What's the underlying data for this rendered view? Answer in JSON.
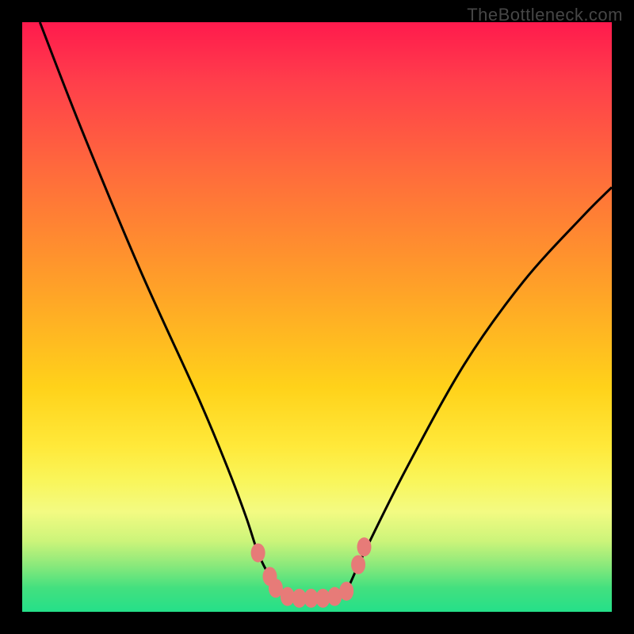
{
  "watermark": "TheBottleneck.com",
  "chart_data": {
    "type": "line",
    "title": "",
    "xlabel": "",
    "ylabel": "",
    "xlim": [
      0,
      100
    ],
    "ylim": [
      0,
      100
    ],
    "series": [
      {
        "name": "bottleneck-curve",
        "x": [
          3,
          10,
          20,
          30,
          35,
          38,
          40,
          42,
          44,
          46,
          48,
          50,
          52,
          54,
          55,
          58,
          65,
          75,
          85,
          95,
          100
        ],
        "values": [
          100,
          82,
          58,
          36,
          24,
          16,
          10,
          6,
          3.5,
          2.5,
          2.3,
          2.3,
          2.3,
          2.5,
          3.5,
          10,
          24,
          42,
          56,
          67,
          72
        ]
      }
    ],
    "markers": {
      "name": "highlighted-points",
      "color": "#e77b78",
      "points": [
        {
          "x": 40,
          "y": 10
        },
        {
          "x": 42,
          "y": 6
        },
        {
          "x": 43,
          "y": 4
        },
        {
          "x": 45,
          "y": 2.6
        },
        {
          "x": 47,
          "y": 2.3
        },
        {
          "x": 49,
          "y": 2.3
        },
        {
          "x": 51,
          "y": 2.3
        },
        {
          "x": 53,
          "y": 2.6
        },
        {
          "x": 55,
          "y": 3.5
        },
        {
          "x": 57,
          "y": 8
        },
        {
          "x": 58,
          "y": 11
        }
      ]
    },
    "colors": {
      "background_top": "#ff1a4d",
      "background_bottom": "#25e089",
      "curve": "#000000",
      "frame": "#000000",
      "marker": "#e77b78"
    }
  }
}
